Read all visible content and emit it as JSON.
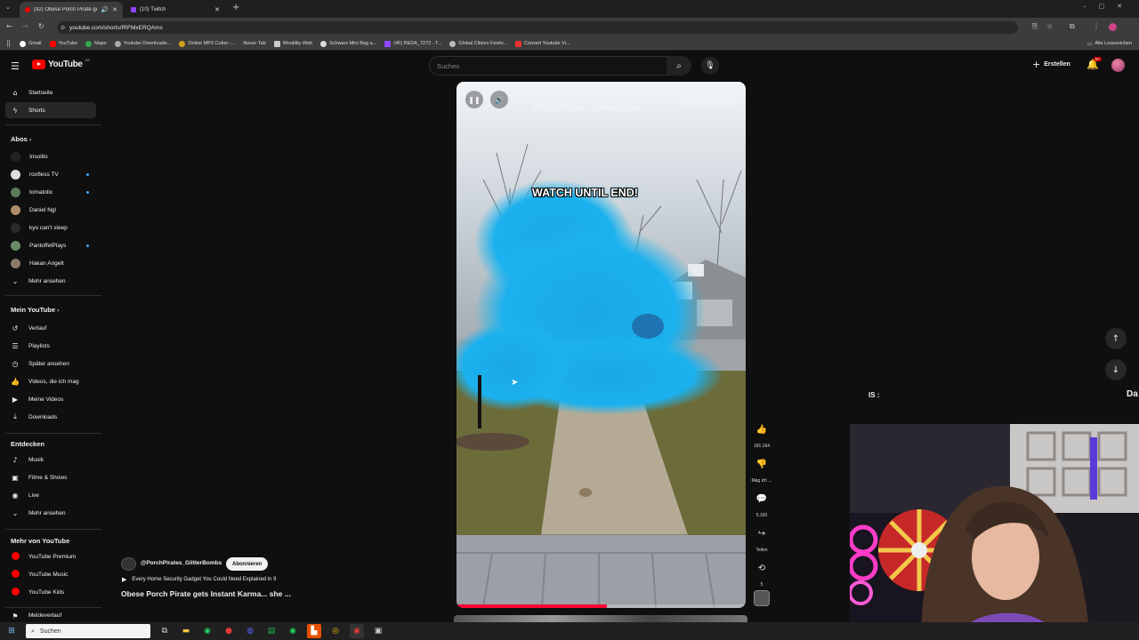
{
  "browser": {
    "tabs": [
      {
        "label": "(92) Obese Porch Pirate ge"
      },
      {
        "label": "(10) Twitch"
      }
    ],
    "url": "youtube.com/shorts/fRFMxERQAms",
    "bookmarks": [
      "Gmail",
      "YouTube",
      "Maps",
      "Youtube Downloade...",
      "Online MP3 Cutter -...",
      "Neuer Tab",
      "Wootility Web",
      "Schwarz Mini Bag a...",
      "(45) REDA_7272 - T...",
      "Global Citizen Festiv...",
      "Convert Youtube Vi..."
    ],
    "all_bookmarks": "Alle Lesezeichen"
  },
  "header": {
    "logo": "YouTube",
    "logo_region": "DE",
    "search_placeholder": "Suchen",
    "create_label": "Erstellen",
    "notif_count": "9+"
  },
  "sidebar": {
    "main": [
      {
        "label": "Startseite",
        "icon": "home-icon",
        "glyph": "⌂"
      },
      {
        "label": "Shorts",
        "icon": "shorts-icon",
        "glyph": "ϟ"
      }
    ],
    "subs_heading": "Abos",
    "subs": [
      {
        "label": "Insolito",
        "color": "#222222",
        "dot": false
      },
      {
        "label": "roofless TV",
        "color": "#dddddd",
        "dot": true
      },
      {
        "label": "tomatolix",
        "color": "#5a7a5a",
        "dot": true
      },
      {
        "label": "Daniel Ngl",
        "color": "#b08d6a",
        "dot": false
      },
      {
        "label": "kyo can't sleep",
        "color": "#2a2a2a",
        "dot": false
      },
      {
        "label": "PantoffelPlays",
        "color": "#6a8a6a",
        "dot": true
      },
      {
        "label": "Hakan Angelt",
        "color": "#8a7a6a",
        "dot": false
      }
    ],
    "subs_more": "Mehr ansehen",
    "you_heading": "Mein YouTube",
    "you": [
      {
        "label": "Verlauf",
        "glyph": "↺",
        "icon": "history-icon"
      },
      {
        "label": "Playlists",
        "glyph": "☰",
        "icon": "playlist-icon"
      },
      {
        "label": "Später ansehen",
        "glyph": "◷",
        "icon": "clock-icon"
      },
      {
        "label": "Videos, die ich mag",
        "glyph": "👍",
        "icon": "thumb-up-icon"
      },
      {
        "label": "Meine Videos",
        "glyph": "▶",
        "icon": "my-videos-icon"
      },
      {
        "label": "Downloads",
        "glyph": "⤓",
        "icon": "download-icon"
      }
    ],
    "explore_heading": "Entdecken",
    "explore": [
      {
        "label": "Musik",
        "glyph": "♪",
        "icon": "music-icon"
      },
      {
        "label": "Filme & Shows",
        "glyph": "▣",
        "icon": "film-icon"
      },
      {
        "label": "Live",
        "glyph": "◉",
        "icon": "live-icon"
      },
      {
        "label": "Mehr ansehen",
        "glyph": "⌄",
        "icon": "chevron-down-icon"
      }
    ],
    "more_heading": "Mehr von YouTube",
    "more": [
      {
        "label": "YouTube Premium"
      },
      {
        "label": "YouTube Music"
      },
      {
        "label": "YouTube Kids"
      }
    ],
    "cut_item": "Meldeverlauf"
  },
  "video": {
    "channel_overlay": "@PorchPirates_GlitterBombs",
    "overlay_text": "WATCH UNTIL END!",
    "progress": 0.52
  },
  "actions": {
    "likes": "181.164",
    "dislike_label": "Mag ich ...",
    "comments": "5.160",
    "share_label": "Teilen",
    "remix_count": "5"
  },
  "info": {
    "channel": "@PorchPirates_GlitterBombs",
    "subscribe_label": "Abonnieren",
    "playlist_line": "Every Home Security Gadget You Could Need Explained in 9",
    "title": "Obese Porch Pirate gets Instant Karma... she ..."
  },
  "right_partial": {
    "left_fragment": "IS :",
    "right_fragment": "Da"
  },
  "taskbar": {
    "search_label": "Suchen"
  }
}
